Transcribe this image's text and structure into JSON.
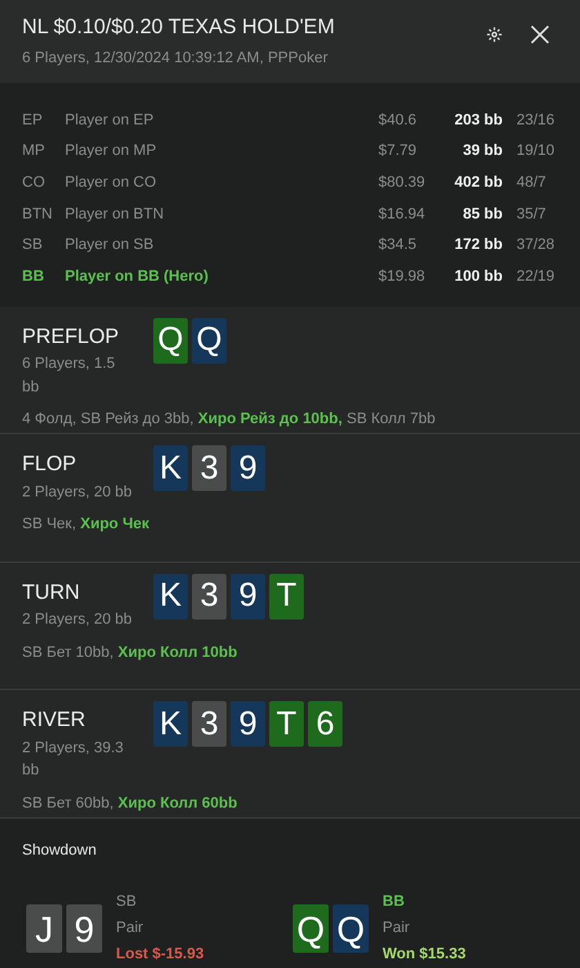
{
  "header": {
    "title": "NL $0.10/$0.20 TEXAS HOLD'EM",
    "subtitle": "6 Players, 12/30/2024 10:39:12 AM, PPPoker"
  },
  "players": [
    {
      "position": "EP",
      "name": "Player on EP",
      "stack": "$40.6",
      "bb": "203 bb",
      "stats": "23/16",
      "hero": false
    },
    {
      "position": "MP",
      "name": "Player on MP",
      "stack": "$7.79",
      "bb": "39 bb",
      "stats": "19/10",
      "hero": false
    },
    {
      "position": "CO",
      "name": "Player on CO",
      "stack": "$80.39",
      "bb": "402 bb",
      "stats": "48/7",
      "hero": false
    },
    {
      "position": "BTN",
      "name": "Player on BTN",
      "stack": "$16.94",
      "bb": "85 bb",
      "stats": "35/7",
      "hero": false
    },
    {
      "position": "SB",
      "name": "Player on SB",
      "stack": "$34.5",
      "bb": "172 bb",
      "stats": "37/28",
      "hero": false
    },
    {
      "position": "BB",
      "name": "Player on BB (Hero)",
      "stack": "$19.98",
      "bb": "100 bb",
      "stats": "22/19",
      "hero": true
    }
  ],
  "streets": [
    {
      "name": "PREFLOP",
      "info": "6 Players, 1.5 bb",
      "cards": [
        {
          "rank": "Q",
          "color": "#1e6b1e"
        },
        {
          "rank": "Q",
          "color": "#14375a"
        }
      ],
      "actions": [
        {
          "text": "4 Фолд, SB Рейз до 3bb, ",
          "hero": false
        },
        {
          "text": "Хиро Рейз до 10bb,",
          "hero": true
        },
        {
          "text": " SB Колл 7bb",
          "hero": false
        }
      ]
    },
    {
      "name": "FLOP",
      "info": "2 Players, 20 bb",
      "cards": [
        {
          "rank": "K",
          "color": "#14375a"
        },
        {
          "rank": "3",
          "color": "#4a4c4c"
        },
        {
          "rank": "9",
          "color": "#14375a"
        }
      ],
      "actions": [
        {
          "text": "SB Чек, ",
          "hero": false
        },
        {
          "text": "Хиро Чек",
          "hero": true
        }
      ]
    },
    {
      "name": "TURN",
      "info": "2 Players, 20 bb",
      "cards": [
        {
          "rank": "K",
          "color": "#14375a"
        },
        {
          "rank": "3",
          "color": "#4a4c4c"
        },
        {
          "rank": "9",
          "color": "#14375a"
        },
        {
          "rank": "T",
          "color": "#1e6b1e"
        }
      ],
      "actions": [
        {
          "text": "SB Бет 10bb, ",
          "hero": false
        },
        {
          "text": "Хиро Колл 10bb",
          "hero": true
        }
      ]
    },
    {
      "name": "RIVER",
      "info": "2 Players, 39.3 bb",
      "cards": [
        {
          "rank": "K",
          "color": "#14375a"
        },
        {
          "rank": "3",
          "color": "#4a4c4c"
        },
        {
          "rank": "9",
          "color": "#14375a"
        },
        {
          "rank": "T",
          "color": "#1e6b1e"
        },
        {
          "rank": "6",
          "color": "#1e6b1e"
        }
      ],
      "actions": [
        {
          "text": "SB Бет 60bb, ",
          "hero": false
        },
        {
          "text": "Хиро Колл 60bb",
          "hero": true
        }
      ]
    }
  ],
  "showdown": {
    "title": "Showdown",
    "hands": [
      {
        "cards": [
          {
            "rank": "J",
            "color": "#4a4c4c"
          },
          {
            "rank": "9",
            "color": "#4a4c4c"
          }
        ],
        "position": "SB",
        "hand": "Pair",
        "result": "Lost $-15.93",
        "hero": false,
        "won": false
      },
      {
        "cards": [
          {
            "rank": "Q",
            "color": "#1e6b1e"
          },
          {
            "rank": "Q",
            "color": "#14375a"
          }
        ],
        "position": "BB",
        "hand": "Pair",
        "result": "Won $15.33",
        "hero": true,
        "won": true
      }
    ]
  }
}
